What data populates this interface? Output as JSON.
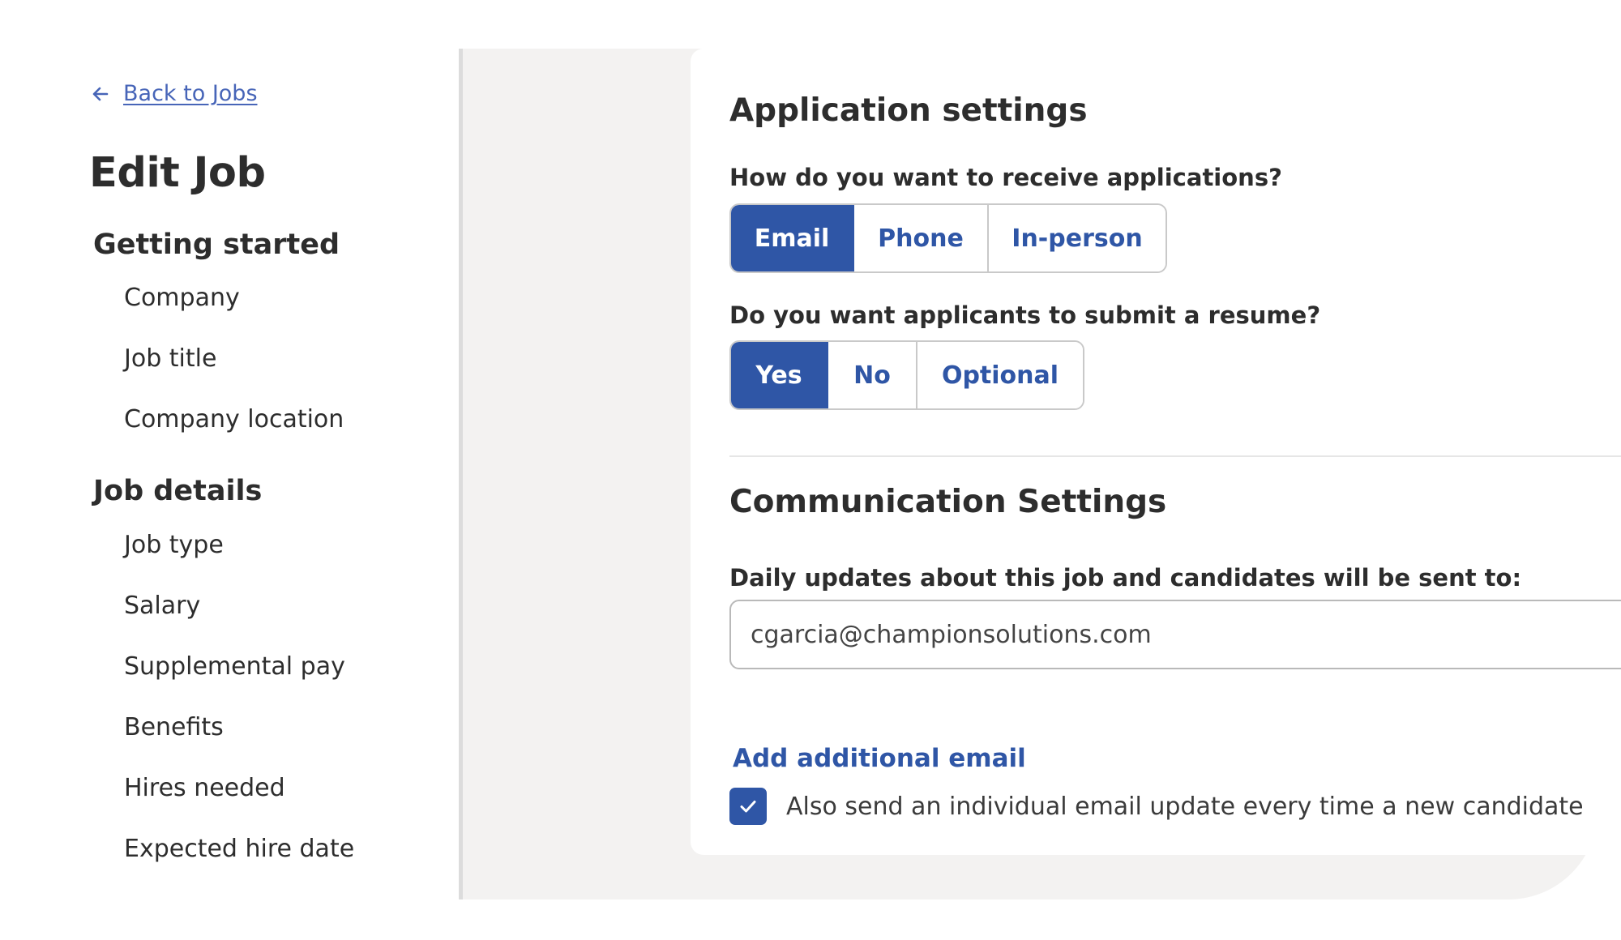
{
  "sidebar": {
    "back_link": "Back to Jobs",
    "title": "Edit Job",
    "sections": [
      {
        "heading": "Getting started",
        "items": [
          "Company",
          "Job title",
          "Company location"
        ]
      },
      {
        "heading": "Job details",
        "items": [
          "Job type",
          "Salary",
          "Supplemental pay",
          "Benefits",
          "Hires needed",
          "Expected hire date"
        ]
      }
    ]
  },
  "application_settings": {
    "title": "Application settings",
    "receive_question": "How do you want to receive applications?",
    "receive_options": [
      "Email",
      "Phone",
      "In-person"
    ],
    "receive_selected": "Email",
    "resume_question": "Do you want applicants to submit a resume?",
    "resume_options": [
      "Yes",
      "No",
      "Optional"
    ],
    "resume_selected": "Yes"
  },
  "communication_settings": {
    "title": "Communication Settings",
    "updates_label": "Daily updates about this job and candidates will be sent to:",
    "email_value": "cgarcia@championsolutions.com",
    "add_email_label": "Add additional email",
    "individual_update_checked": true,
    "individual_update_label": "Also send an individual email update every time a new candidate"
  },
  "colors": {
    "accent": "#2f56a6",
    "link": "#4765b8",
    "gray_bg": "#f3f2f1"
  },
  "icons": {
    "back": "arrow-left-icon",
    "check": "checkmark-icon"
  }
}
